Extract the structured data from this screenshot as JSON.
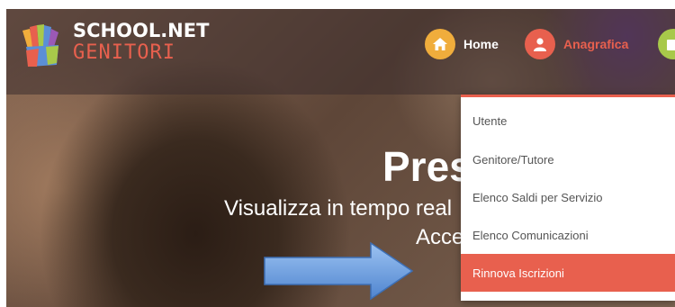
{
  "logo": {
    "line1": "SCHOOL.NET",
    "line2": "GENITORI",
    "icon": "colored-hands-icon"
  },
  "nav": {
    "home": {
      "label": "Home",
      "icon": "home-icon"
    },
    "anagrafica": {
      "label": "Anagrafica",
      "icon": "user-icon"
    },
    "calendar": {
      "icon": "calendar-icon"
    }
  },
  "hero": {
    "title": "Pres",
    "subtitle": "Visualizza in tempo real",
    "subtitle2": "Acce"
  },
  "dropdown": {
    "items": [
      {
        "label": "Utente",
        "active": false
      },
      {
        "label": "Genitore/Tutore",
        "active": false
      },
      {
        "label": "Elenco Saldi per Servizio",
        "active": false
      },
      {
        "label": "Elenco Comunicazioni",
        "active": false
      },
      {
        "label": "Rinnova Iscrizioni",
        "active": true
      }
    ]
  },
  "colors": {
    "accent": "#e8604e",
    "home_circle": "#f0ad3c",
    "calendar_circle": "#a8c94a",
    "arrow": "#5b8fd6"
  }
}
